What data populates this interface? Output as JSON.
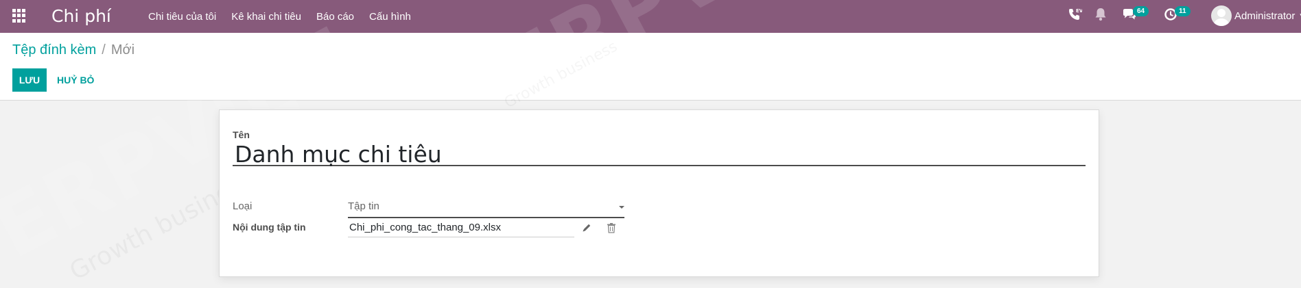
{
  "navbar": {
    "app_name": "Chi phí",
    "menu": [
      "Chi tiêu của tôi",
      "Kê khai chi tiêu",
      "Báo cáo",
      "Cấu hình"
    ],
    "voip_label": "EV",
    "messages_count": "64",
    "activities_count": "11",
    "user_name": "Administrator"
  },
  "breadcrumb": {
    "parent": "Tệp đính kèm",
    "separator": "/",
    "current": "Mới"
  },
  "buttons": {
    "save": "LƯU",
    "discard": "HUỶ BỎ"
  },
  "form": {
    "name_label": "Tên",
    "name_value": "Danh mục chi tiêu",
    "type_label": "Loại",
    "type_value": "Tập tin",
    "content_label": "Nội dung tập tin",
    "file_name": "Chi_phi_cong_tac_thang_09.xlsx"
  },
  "colors": {
    "navbar": "#875a7b",
    "primary": "#00a09d"
  }
}
